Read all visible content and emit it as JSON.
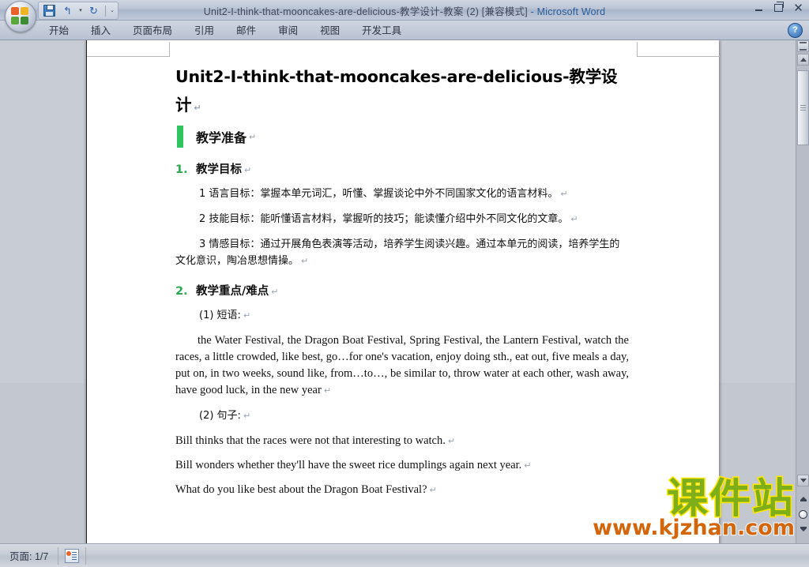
{
  "window": {
    "title": "Unit2-I-think-that-mooncakes-are-delicious-教学设计-教案 (2) [兼容模式]",
    "app_suffix": " -  Microsoft Word",
    "minimize_label": "最小化",
    "restore_label": "还原",
    "close_label": "关闭"
  },
  "quick_access": {
    "save_label": "保存",
    "undo_label": "撤消",
    "undo_dropdown": "▾",
    "redo_label": "恢复",
    "customize_label": "⌄"
  },
  "ribbon": {
    "tabs": [
      {
        "label": "开始"
      },
      {
        "label": "插入"
      },
      {
        "label": "页面布局"
      },
      {
        "label": "引用"
      },
      {
        "label": "邮件"
      },
      {
        "label": "审阅"
      },
      {
        "label": "视图"
      },
      {
        "label": "开发工具"
      }
    ],
    "help_label": "?"
  },
  "document": {
    "title": "Unit2-I-think-that-mooncakes-are-delicious-教学设计",
    "title_pilcrow": "↵",
    "heading2": "教学准备",
    "heading2_pilcrow": "↵",
    "sections": [
      {
        "number": "1.",
        "heading": "教学目标",
        "pilcrow": "↵",
        "paragraphs": [
          "1 语言目标：掌握本单元词汇，听懂、掌握谈论中外不同国家文化的语言材料。",
          "2 技能目标：能听懂语言材料，掌握听的技巧；能读懂介绍中外不同文化的文章。",
          "3 情感目标：通过开展角色表演等活动，培养学生阅读兴趣。通过本单元的阅读，培养学生的文化意识，陶冶思想情操。"
        ]
      },
      {
        "number": "2.",
        "heading": "教学重点/难点",
        "pilcrow": "↵"
      }
    ],
    "sub_items": [
      {
        "label": "(1) 短语:",
        "pilcrow": "↵"
      },
      {
        "label": "(2) 句子:",
        "pilcrow": "↵"
      }
    ],
    "phrase_block": "the Water Festival, the Dragon Boat Festival, Spring Festival, the Lantern Festival, watch the races, a little crowded, like best, go…for one's vacation, enjoy doing sth., eat out, five meals a day, put on, in two weeks, sound like, from…to…, be similar to, throw water at each other, wash away, have good luck, in the new year",
    "sentences": [
      "Bill thinks that the races were not that interesting to watch.",
      "Bill wonders whether they'll have the sweet rice dumplings again next year.",
      "What do you like best about the Dragon Boat Festival?"
    ],
    "pilcrow": "↵"
  },
  "scrollbar": {
    "split_label": "拆分窗口",
    "up_label": "向上滚动",
    "down_label": "向下滚动",
    "prev_page_label": "上一页",
    "browse_label": "选择浏览对象",
    "next_page_label": "下一页"
  },
  "status_bar": {
    "page_indicator": "页面: 1/7",
    "proofing_icon_label": "校对状态"
  },
  "watermark": {
    "cn": "课件站",
    "url": "www.kjzhan.com"
  },
  "colors": {
    "accent_green": "#2ec45f",
    "number_green": "#2aa84f",
    "title_blue": "#2a5c9c",
    "watermark_green": "#7fae1b",
    "watermark_yellow": "#ffe600",
    "watermark_orange": "#d4650a"
  }
}
